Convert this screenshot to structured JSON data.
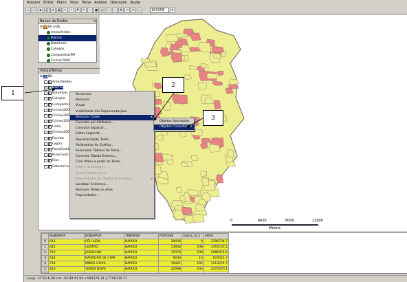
{
  "menu": [
    "Arquivo",
    "Editar",
    "Plano",
    "Vista",
    "Tema",
    "Análise",
    "Operação",
    "Ajuda"
  ],
  "toolbar": {
    "scale_value": "164258"
  },
  "database_panel": {
    "title": "Banco de Dados",
    "root": "bh.mdb",
    "items": [
      "AreasVerdes",
      "Bairros",
      "Batalhoes",
      "Colegios",
      "CompanhiasPM",
      "Crimes2000"
    ]
  },
  "views_panel": {
    "title": "Vistas/Temas",
    "root": "BH",
    "themes": [
      {
        "label": "AreasVerdes",
        "checked": false
      },
      {
        "label": "Bairros",
        "checked": true
      },
      {
        "label": "Batalhoes",
        "checked": false
      },
      {
        "label": "Colegios",
        "checked": false
      },
      {
        "label": "CompanhiasPM",
        "checked": false
      },
      {
        "label": "Crimes2000",
        "checked": false
      },
      {
        "label": "Crimes2001",
        "checked": false
      },
      {
        "label": "Crimes2002",
        "checked": false
      },
      {
        "label": "Linha",
        "checked": false
      },
      {
        "label": "Crimes2003",
        "checked": false
      },
      {
        "label": "Favelas",
        "checked": false
      },
      {
        "label": "Lagoa",
        "checked": false
      },
      {
        "label": "PostoCombustivel",
        "checked": false
      },
      {
        "label": "RuasCentrais",
        "checked": false
      },
      {
        "label": "Rios",
        "checked": false
      },
      {
        "label": "SetoresCensitarios",
        "checked": false
      }
    ]
  },
  "context_menu": [
    {
      "label": "Renomear",
      "disabled": false
    },
    {
      "label": "Remover",
      "disabled": false
    },
    {
      "label": "Visual",
      "disabled": false
    },
    {
      "label": "Visibilidade das Representações...",
      "disabled": false
    },
    {
      "label": "Remover Cores",
      "disabled": false,
      "highlight": true,
      "submenu": true
    },
    {
      "label": "Consulta por Atributos...",
      "disabled": false
    },
    {
      "label": "Consulta Espacial...",
      "disabled": false
    },
    {
      "label": "Editar Legenda...",
      "disabled": false
    },
    {
      "label": "Representação Texto...",
      "disabled": false
    },
    {
      "label": "Parâmetros do Gráfico...",
      "disabled": false
    },
    {
      "label": "Selecionar Tabelas do Tema...",
      "disabled": false
    },
    {
      "label": "Conectar Tabela Externa...",
      "disabled": false
    },
    {
      "label": "Criar Plano a partir do Tema...",
      "disabled": false
    },
    {
      "label": "Inserir de Imagem...",
      "disabled": true
    },
    {
      "label": "Salvar Raster Livro...",
      "disabled": true
    },
    {
      "label": "Propriedades do Objeto de Imagem",
      "disabled": true,
      "submenu": true
    },
    {
      "label": "Localizar Endereço...",
      "disabled": false
    },
    {
      "label": "Remover Todos os Alias",
      "disabled": false
    },
    {
      "label": "Propriedades...",
      "disabled": false
    }
  ],
  "submenu": [
    "Objetos Apontados",
    "Objetos Consultados"
  ],
  "callouts": [
    "1",
    "2",
    "3"
  ],
  "scale_bar": {
    "ticks": [
      "0",
      "4000",
      "8000",
      "12000"
    ],
    "unit": "Meters"
  },
  "map_colors": {
    "yellow": "#eded91",
    "pink": "#e88383",
    "outline": "#7a6a6a"
  },
  "table": {
    "columns": [
      "",
      "NUBAIPOP",
      "NOBAIPOP",
      "TPBAIPOP",
      "POP2000",
      "object_id_1",
      "AREA"
    ],
    "rows": [
      [
        "9",
        "643",
        "CÉU AZUL",
        "BAIRRO",
        "29436",
        "0",
        "3396734.7"
      ],
      [
        "1",
        "642",
        "CENTRO",
        "BAIRRO",
        "13958",
        "196",
        "1764735.1"
      ],
      [
        "2",
        "793",
        "JAQUELINE",
        "BAIRRO",
        "11076",
        "198",
        "2086974.6"
      ],
      [
        "3",
        "614",
        "BARREIRO DE CIMA",
        "BAIRRO",
        "9236",
        "15",
        "974421.7"
      ],
      [
        "4",
        "724",
        "MINAS CAIXA",
        "BAIRRO",
        "10421",
        "192",
        "1113574.7"
      ],
      [
        "5",
        "810",
        "VENDA NOVA",
        "BAIRRO",
        "22098",
        "193",
        "3470370.1"
      ],
      [
        "6",
        "",
        "",
        "",
        "",
        "",
        ""
      ]
    ]
  },
  "status": "Long: -37:52:6.08 Lat: -02:48:41.94  x:599378.34  y:7796330.11"
}
